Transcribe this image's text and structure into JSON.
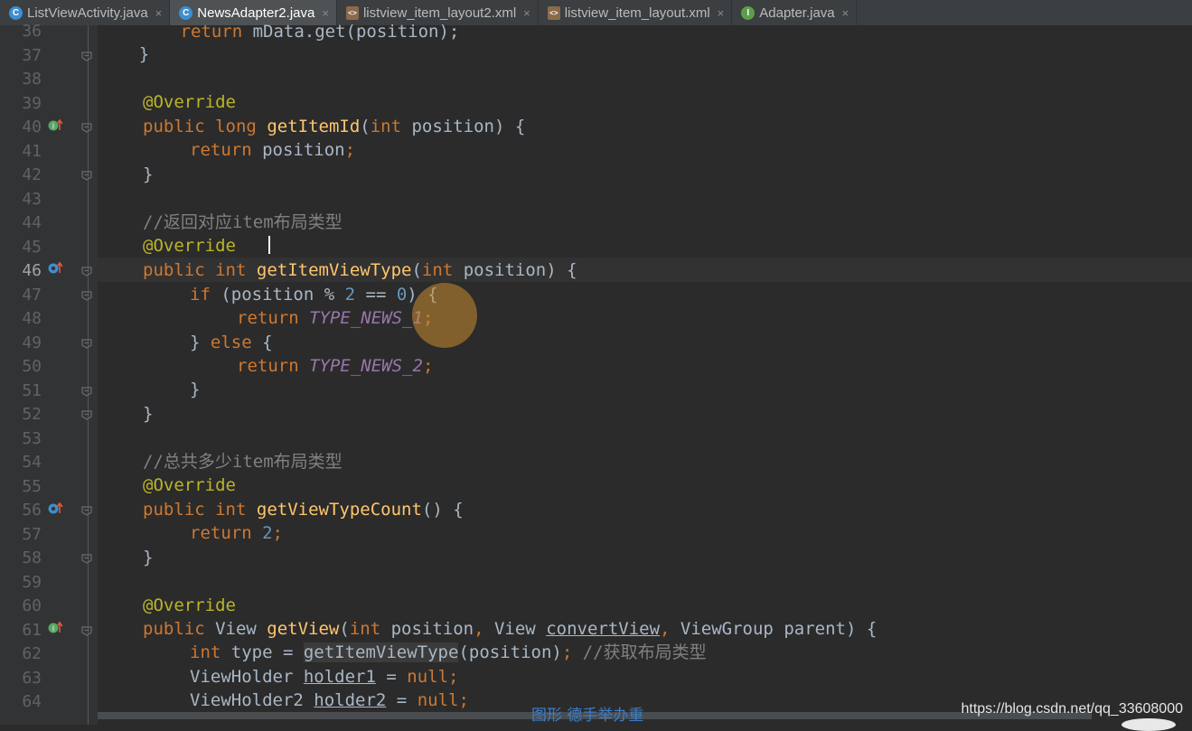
{
  "tabs": [
    {
      "label": "ListViewActivity.java",
      "icon": "class-file-icon",
      "active": false
    },
    {
      "label": "NewsAdapter2.java",
      "icon": "class-file-icon",
      "active": true
    },
    {
      "label": "listview_item_layout2.xml",
      "icon": "xml-file-icon",
      "active": false
    },
    {
      "label": "listview_item_layout.xml",
      "icon": "xml-file-icon",
      "active": false
    },
    {
      "label": "Adapter.java",
      "icon": "interface-file-icon",
      "active": false
    }
  ],
  "tab_close_glyph": "×",
  "line_numbers": [
    "36",
    "37",
    "38",
    "39",
    "40",
    "41",
    "42",
    "43",
    "44",
    "45",
    "46",
    "47",
    "48",
    "49",
    "50",
    "51",
    "52",
    "53",
    "54",
    "55",
    "56",
    "57",
    "58",
    "59",
    "60",
    "61",
    "62",
    "63",
    "64"
  ],
  "current_line": "46",
  "code": {
    "l36": [
      "        ",
      "return",
      " mData.get(position);"
    ],
    "l37": "    }",
    "l39": "@Override",
    "l40": [
      "public",
      " ",
      "long",
      " ",
      "getItemId",
      "(",
      "int",
      " position) {"
    ],
    "l41": [
      "return",
      " position",
      ";"
    ],
    "l42": "}",
    "l44": "//返回对应item布局类型",
    "l45": "@Override",
    "l46": [
      "public",
      " ",
      "int",
      " ",
      "getItemViewType",
      "(",
      "int",
      " position) {"
    ],
    "l47": [
      "if",
      " (position % ",
      "2",
      " == ",
      "0",
      ") {"
    ],
    "l48": [
      "return",
      " ",
      "TYPE_NEWS_1",
      ";"
    ],
    "l49": [
      "} ",
      "else",
      " {"
    ],
    "l50": [
      "return",
      " ",
      "TYPE_NEWS_2",
      ";"
    ],
    "l51": "}",
    "l52": "}",
    "l54": "//总共多少item布局类型",
    "l55": "@Override",
    "l56": [
      "public",
      " ",
      "int",
      " ",
      "getViewTypeCount",
      "() {"
    ],
    "l57": [
      "return",
      " ",
      "2",
      ";"
    ],
    "l58": "}",
    "l60": "@Override",
    "l61": [
      "public",
      " View ",
      "getView",
      "(",
      "int",
      " position",
      ",",
      " View ",
      "convertView",
      ",",
      " ViewGroup parent) {"
    ],
    "l62": [
      "int",
      " type = ",
      "getItemViewType",
      "(position)",
      ";",
      " //获取布局类型"
    ],
    "l63": [
      "ViewHolder ",
      "holder1",
      " = ",
      "null",
      ";"
    ],
    "l64": [
      "ViewHolder2 ",
      "holder2",
      " = ",
      "null",
      ";"
    ]
  },
  "watermark": "https://blog.csdn.net/qq_33608000",
  "subtitle": "图形  德手举办重",
  "colors": {
    "background": "#2b2b2b",
    "keyword": "#cc7832",
    "annotation": "#bbb529",
    "function": "#ffc66d",
    "number": "#6897bb",
    "comment": "#808080",
    "constant": "#9876aa",
    "text": "#a9b7c6"
  }
}
